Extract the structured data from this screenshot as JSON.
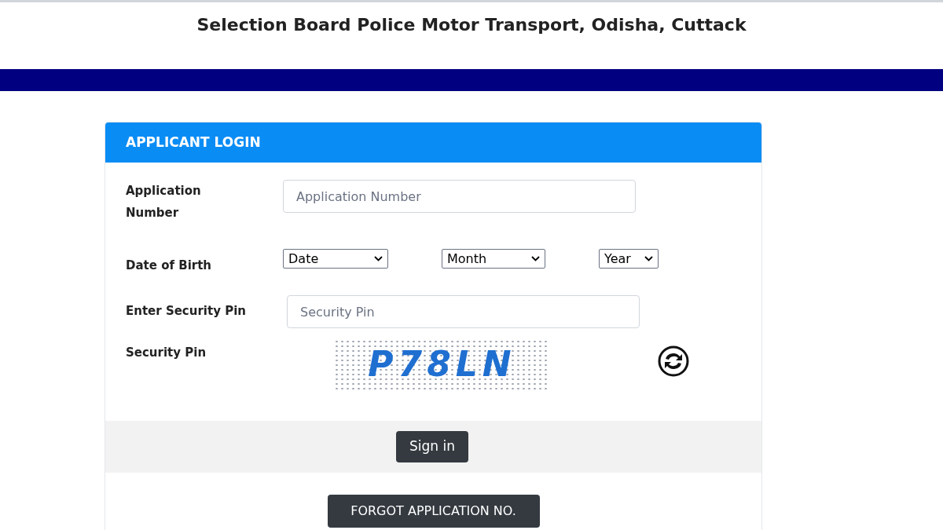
{
  "header": {
    "title": "Selection Board Police Motor Transport, Odisha, Cuttack"
  },
  "login": {
    "title": "APPLICANT LOGIN",
    "application_number": {
      "label": "Application Number",
      "placeholder": "Application Number"
    },
    "date_of_birth": {
      "label": "Date of Birth",
      "selects": [
        "Date",
        "Month",
        "Year"
      ]
    },
    "security_pin_input": {
      "label": "Enter Security Pin",
      "placeholder": "Security Pin"
    },
    "captcha": {
      "label": "Security Pin",
      "code": "P78LN"
    },
    "sign_in": "Sign in",
    "forgot": "FORGOT APPLICATION NO."
  }
}
